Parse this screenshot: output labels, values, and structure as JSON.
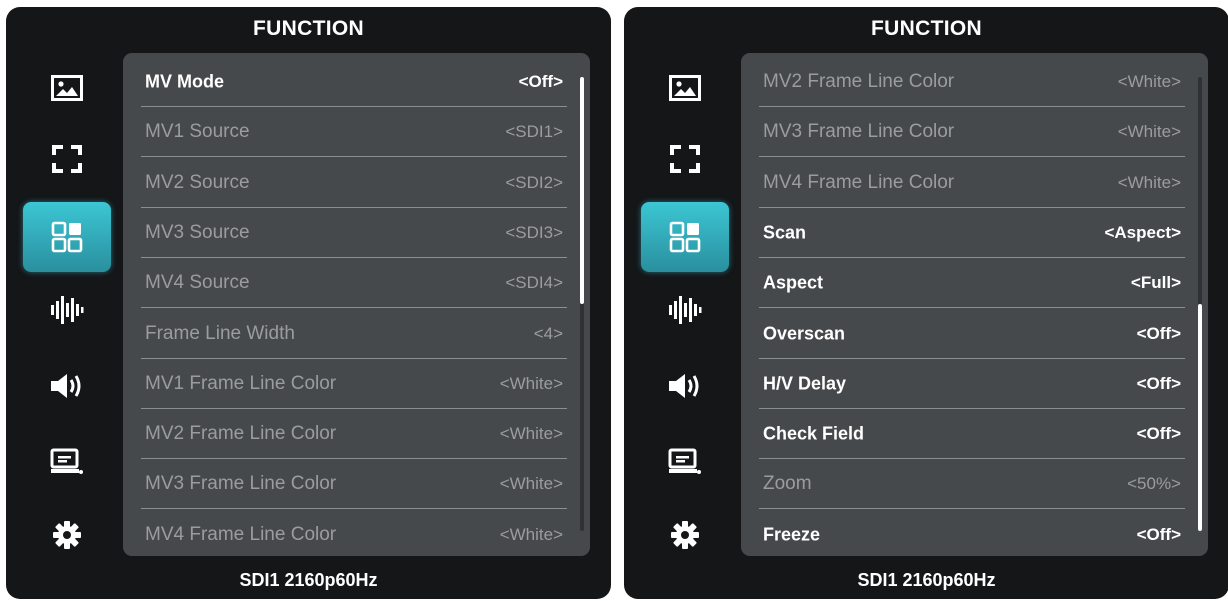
{
  "left_panel": {
    "title": "FUNCTION",
    "footer": "SDI1 2160p60Hz",
    "scroll": {
      "start_fraction": 0.0,
      "visible_fraction": 0.5
    },
    "rows": [
      {
        "label": "MV Mode",
        "value": "<Off>",
        "enabled": true
      },
      {
        "label": "MV1 Source",
        "value": "<SDI1>",
        "enabled": false
      },
      {
        "label": "MV2 Source",
        "value": "<SDI2>",
        "enabled": false
      },
      {
        "label": "MV3 Source",
        "value": "<SDI3>",
        "enabled": false
      },
      {
        "label": "MV4 Source",
        "value": "<SDI4>",
        "enabled": false
      },
      {
        "label": "Frame Line Width",
        "value": "<4>",
        "enabled": false
      },
      {
        "label": "MV1 Frame Line Color",
        "value": "<White>",
        "enabled": false
      },
      {
        "label": "MV2 Frame Line Color",
        "value": "<White>",
        "enabled": false
      },
      {
        "label": "MV3 Frame Line Color",
        "value": "<White>",
        "enabled": false
      },
      {
        "label": "MV4 Frame Line Color",
        "value": "<White>",
        "enabled": false
      }
    ]
  },
  "right_panel": {
    "title": "FUNCTION",
    "footer": "SDI1 2160p60Hz",
    "scroll": {
      "start_fraction": 0.5,
      "visible_fraction": 0.5
    },
    "rows": [
      {
        "label": "MV2 Frame Line Color",
        "value": "<White>",
        "enabled": false
      },
      {
        "label": "MV3 Frame Line Color",
        "value": "<White>",
        "enabled": false
      },
      {
        "label": "MV4 Frame Line Color",
        "value": "<White>",
        "enabled": false
      },
      {
        "label": "Scan",
        "value": "<Aspect>",
        "enabled": true
      },
      {
        "label": "Aspect",
        "value": "<Full>",
        "enabled": true
      },
      {
        "label": "Overscan",
        "value": "<Off>",
        "enabled": true
      },
      {
        "label": "H/V Delay",
        "value": "<Off>",
        "enabled": true
      },
      {
        "label": "Check Field",
        "value": "<Off>",
        "enabled": true
      },
      {
        "label": "Zoom",
        "value": "<50%>",
        "enabled": false
      },
      {
        "label": "Freeze",
        "value": "<Off>",
        "enabled": true
      }
    ]
  },
  "sidebar": {
    "active_index": 2,
    "items": [
      {
        "icon": "image-icon"
      },
      {
        "icon": "frame-corners-icon"
      },
      {
        "icon": "multiview-grid-icon"
      },
      {
        "icon": "waveform-icon"
      },
      {
        "icon": "speaker-icon"
      },
      {
        "icon": "monitor-icon"
      },
      {
        "icon": "gear-icon"
      }
    ]
  },
  "colors": {
    "panel_bg": "#141618",
    "list_bg": "#46494c",
    "accent": "#3cc6d4",
    "text_enabled": "#ffffff",
    "text_disabled": "#9a9c9e"
  }
}
